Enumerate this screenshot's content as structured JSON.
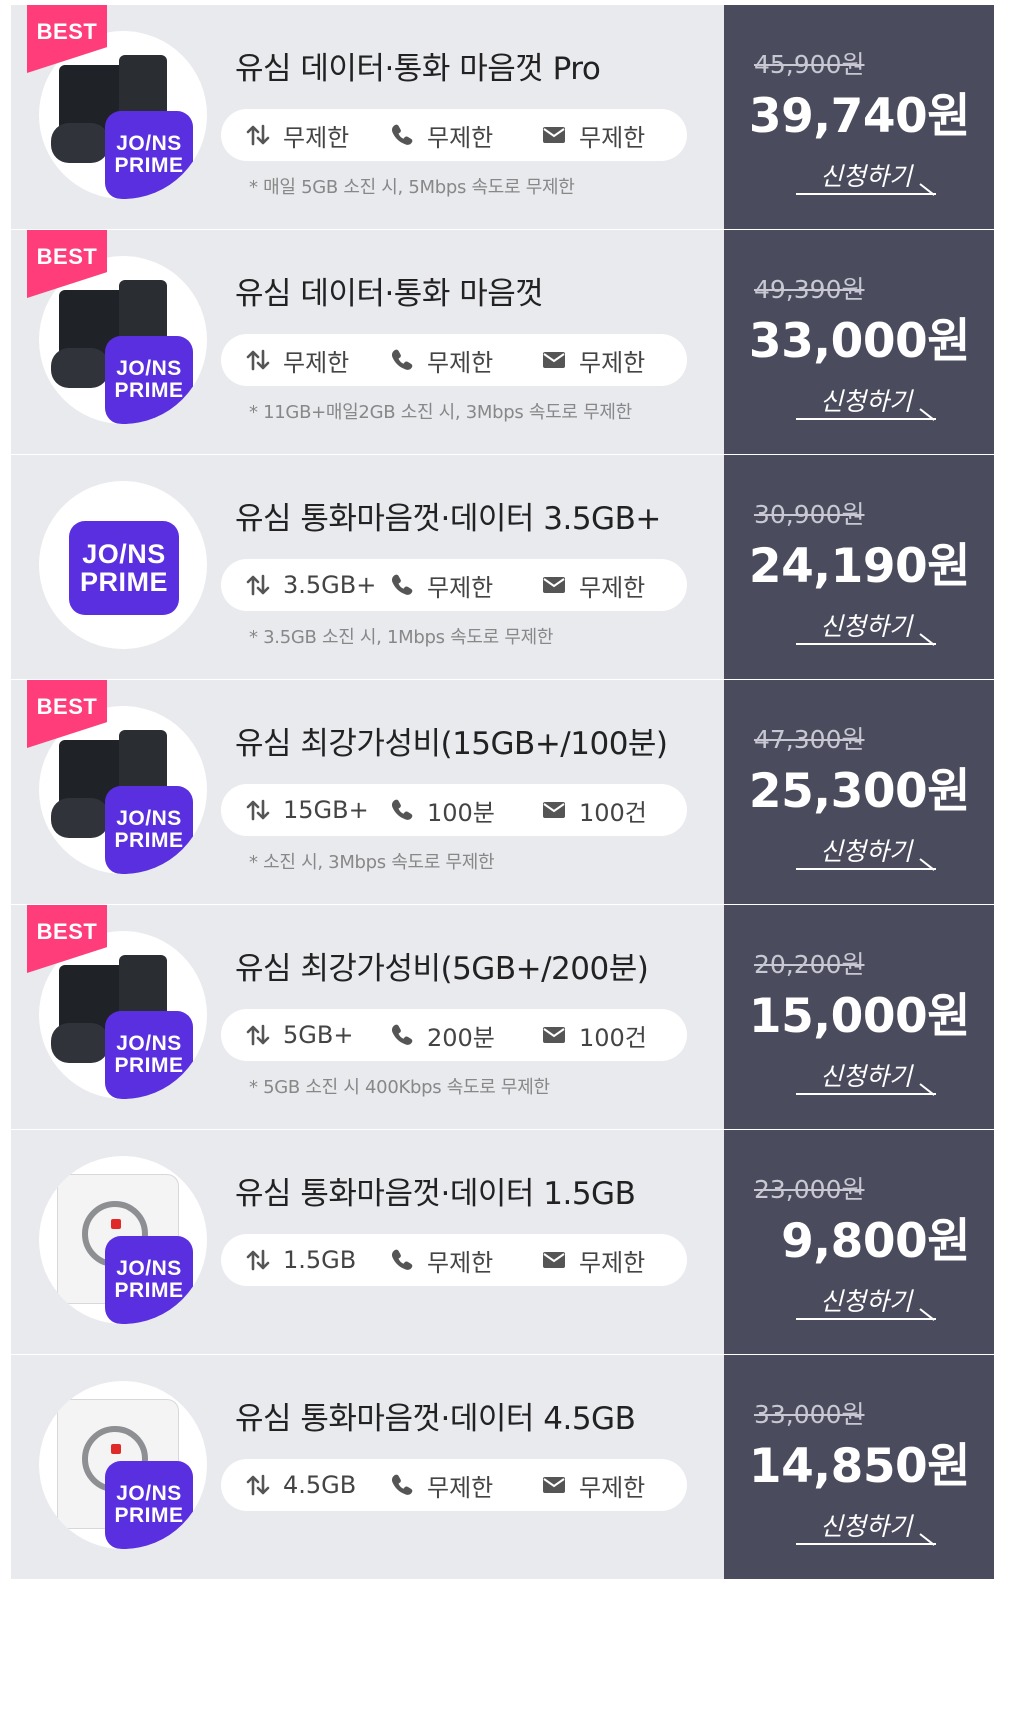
{
  "colors": {
    "card_bg": "#e9eaee",
    "price_bg": "#4a4b5d",
    "best_badge": "#ff3d7a",
    "brand": "#5a2fe0"
  },
  "brand_badge": {
    "line1": "JO/NS",
    "line2": "PRIME"
  },
  "best_label": "BEST",
  "apply_label": "신청하기",
  "plans": [
    {
      "title": "유심 데이터·통화 마음껏 Pro",
      "best": true,
      "image": "black-device",
      "data": "무제한",
      "call": "무제한",
      "sms": "무제한",
      "note": "* 매일 5GB 소진 시, 5Mbps 속도로 무제한",
      "original_price": "45,900원",
      "price": "39,740원"
    },
    {
      "title": "유심 데이터·통화 마음껏",
      "best": true,
      "image": "black-device",
      "data": "무제한",
      "call": "무제한",
      "sms": "무제한",
      "note": "* 11GB+매일2GB 소진 시, 3Mbps 속도로 무제한",
      "original_price": "49,390원",
      "price": "33,000원"
    },
    {
      "title": "유심 통화마음껏·데이터 3.5GB+",
      "best": false,
      "image": "brand-only",
      "data": "3.5GB+",
      "call": "무제한",
      "sms": "무제한",
      "note": "* 3.5GB 소진 시, 1Mbps 속도로 무제한",
      "original_price": "30,900원",
      "price": "24,190원"
    },
    {
      "title": "유심 최강가성비(15GB+/100분)",
      "best": true,
      "image": "black-device",
      "data": "15GB+",
      "call": "100분",
      "sms": "100건",
      "note": "* 소진 시, 3Mbps 속도로 무제한",
      "original_price": "47,300원",
      "price": "25,300원"
    },
    {
      "title": "유심 최강가성비(5GB+/200분)",
      "best": true,
      "image": "black-device",
      "data": "5GB+",
      "call": "200분",
      "sms": "100건",
      "note": "* 5GB 소진 시 400Kbps 속도로 무제한",
      "original_price": "20,200원",
      "price": "15,000원"
    },
    {
      "title": "유심 통화마음껏·데이터 1.5GB",
      "best": false,
      "image": "white-device",
      "data": "1.5GB",
      "call": "무제한",
      "sms": "무제한",
      "note": "",
      "original_price": "23,000원",
      "price": "9,800원"
    },
    {
      "title": "유심 통화마음껏·데이터 4.5GB",
      "best": false,
      "image": "white-device",
      "data": "4.5GB",
      "call": "무제한",
      "sms": "무제한",
      "note": "",
      "original_price": "33,000원",
      "price": "14,850원"
    }
  ]
}
